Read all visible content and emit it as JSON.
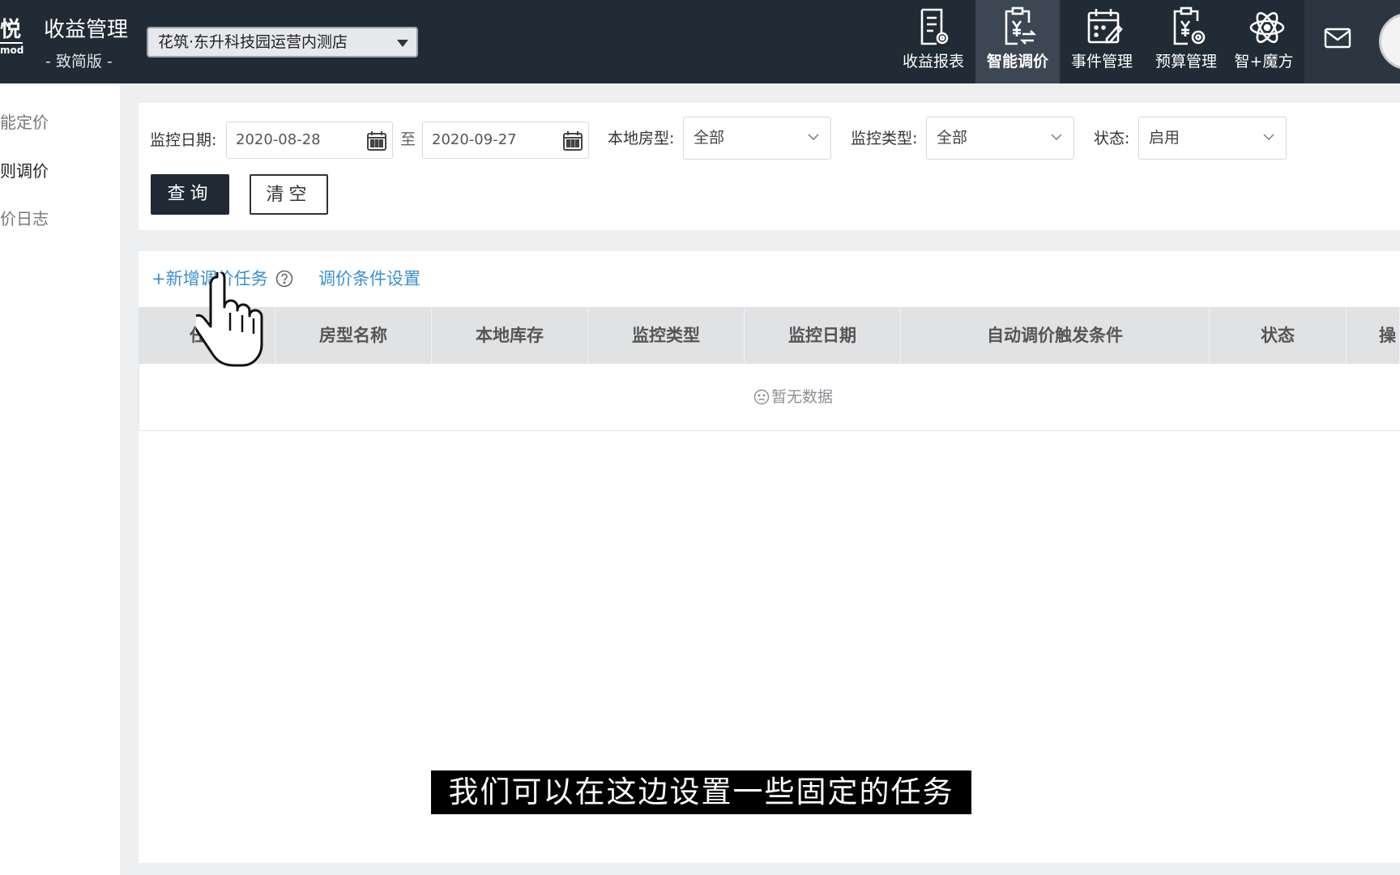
{
  "header": {
    "logo_glyph": "悦",
    "logo_sub": "mod",
    "app_title": "收益管理",
    "edition": "- 致简版 -",
    "store_select": "花筑·东升科技园运营内测店",
    "nav": [
      {
        "label": "收益报表",
        "icon": "report-icon"
      },
      {
        "label": "智能调价",
        "icon": "pricing-clipboard-icon",
        "active": true
      },
      {
        "label": "事件管理",
        "icon": "calendar-edit-icon"
      },
      {
        "label": "预算管理",
        "icon": "budget-clipboard-icon"
      },
      {
        "label": "智+魔方",
        "icon": "atom-icon"
      }
    ],
    "mail_icon": "mail-icon"
  },
  "sidebar": {
    "items": [
      {
        "label": "能定价"
      },
      {
        "label": "则调价"
      },
      {
        "label": "价日志"
      }
    ]
  },
  "filters": {
    "date_label": "监控日期:",
    "date_start": "2020-08-28",
    "date_sep": "至",
    "date_end": "2020-09-27",
    "room_type_label": "本地房型:",
    "room_type_value": "全部",
    "monitor_type_label": "监控类型:",
    "monitor_type_value": "全部",
    "status_label": "状态:",
    "status_value": "启用",
    "query_button": "查询",
    "clear_button": "清空"
  },
  "list": {
    "add_task_link": "+新增调价任务",
    "condition_link": "调价条件设置",
    "columns": [
      "任务",
      "房型名称",
      "本地库存",
      "监控类型",
      "监控日期",
      "自动调价触发条件",
      "状态",
      "操"
    ],
    "empty_text": "暂无数据"
  },
  "subtitle": "我们可以在这边设置一些固定的任务",
  "colors": {
    "topbar": "#212b35",
    "active_nav": "#3c4753",
    "link": "#3a8fd0",
    "primary_button": "#1f2a35"
  }
}
